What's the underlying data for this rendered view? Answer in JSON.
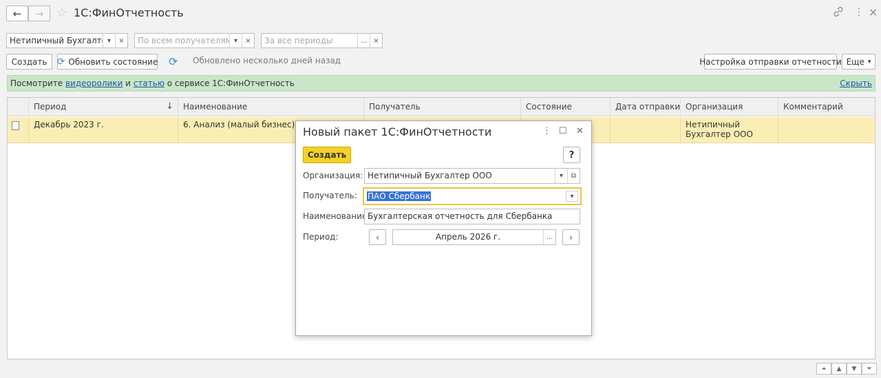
{
  "window": {
    "title": "1С:ФинОтчетность",
    "back_icon": "←",
    "forward_icon": "→",
    "star_icon": "☆",
    "link_icon": "🔗",
    "menu_icon": "⋮",
    "close_icon": "×"
  },
  "filters": {
    "organization": {
      "value": "Нетипичный Бухгалтер ОО"
    },
    "recipient": {
      "placeholder": "По всем получателям"
    },
    "period": {
      "placeholder": "За все периоды"
    },
    "dropdown_glyph": "▾",
    "clear_glyph": "×",
    "choose_glyph": "..."
  },
  "toolbar": {
    "create_label": "Создать",
    "refresh_label": "Обновить состояние",
    "status_text": "Обновлено несколько дней назад",
    "send_settings_label": "Настройка отправки отчетности",
    "more_label": "Еще",
    "refresh_glyph": "⟳"
  },
  "banner": {
    "prefix": "Посмотрите",
    "link1": "видеоролики",
    "mid1": "и",
    "link2": "статью",
    "suffix": "о сервисе 1С:ФинОтчетность",
    "hide_label": "Скрыть",
    "color": "#c9e6c9"
  },
  "table": {
    "columns": [
      "Период",
      "Наименование",
      "Получатель",
      "Состояние",
      "Дата отправки",
      "Организация",
      "Комментарий"
    ],
    "sort_glyph": "↓",
    "rows": [
      {
        "period": "Декабрь 2023 г.",
        "name": "6. Анализ (малый бизнес)",
        "recipient": "",
        "status": "",
        "sent_date": "",
        "organization": "Нетипичный Бухгалтер ООО",
        "comment": ""
      }
    ],
    "selected_row_color": "#fbeeb5"
  },
  "scroll": {
    "first": "⏶",
    "up": "▲",
    "down": "▼",
    "last": "⏷"
  },
  "dialog": {
    "title": "Новый пакет 1С:ФинОтчетности",
    "create_label": "Создать",
    "help_label": "?",
    "menu_icon": "⋮",
    "maximize_icon": "☐",
    "close_icon": "✕",
    "organization_label": "Организация:",
    "organization_value": "Нетипичный Бухгалтер ООО",
    "open_glyph": "⧉",
    "recipient_label": "Получатель:",
    "recipient_value": "ПАО Сбербанк",
    "name_label": "Наименование:",
    "name_value": "Бухгалтерская отчетность для Сбербанка",
    "period_label": "Период:",
    "period_value": "Апрель 2026 г.",
    "prev_glyph": "‹",
    "next_glyph": "›",
    "accent_color": "#f4d225"
  }
}
